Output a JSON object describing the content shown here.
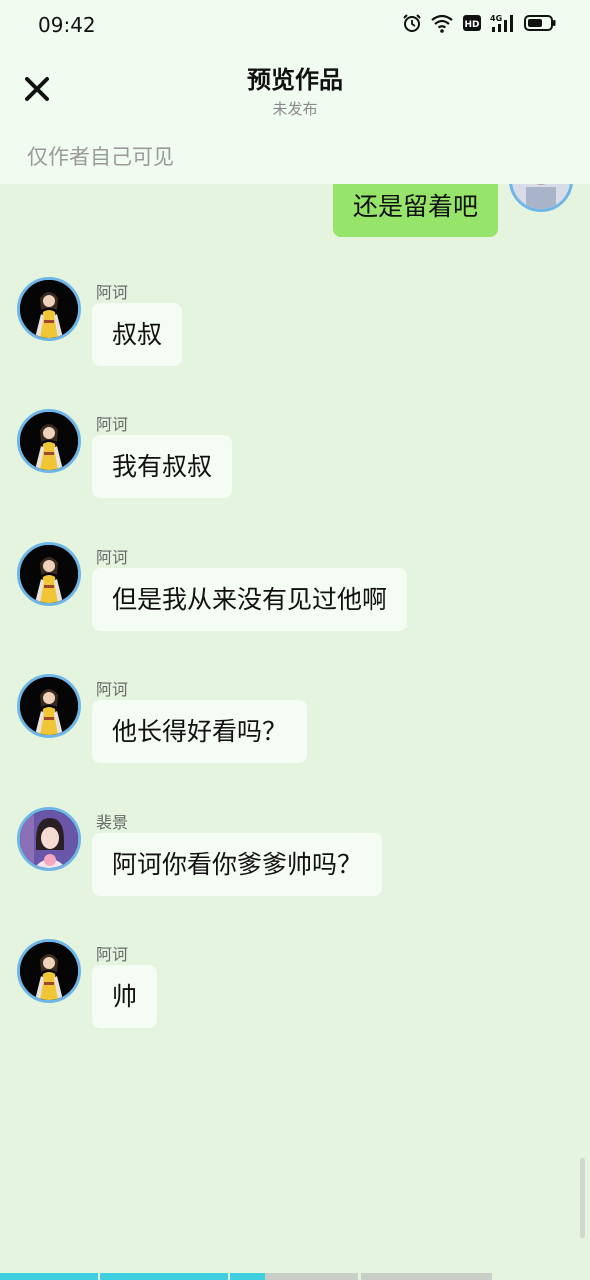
{
  "status_bar": {
    "time": "09:42",
    "icons": [
      "alarm-icon",
      "wifi-icon",
      "hd-icon",
      "signal-4g-icon",
      "battery-icon"
    ]
  },
  "header": {
    "title": "预览作品",
    "subtitle": "未发布",
    "visibility_note": "仅作者自己可见"
  },
  "self_message": {
    "text": "还是留着吧"
  },
  "messages": [
    {
      "sender": "阿诃",
      "text": "叔叔"
    },
    {
      "sender": "阿诃",
      "text": "我有叔叔"
    },
    {
      "sender": "阿诃",
      "text": "但是我从来没有见过他啊"
    },
    {
      "sender": "阿诃",
      "text": "他长得好看吗？"
    },
    {
      "sender": "裴景",
      "text": "阿诃你看你爹爹帅吗？"
    },
    {
      "sender": "阿诃",
      "text": "帅"
    }
  ],
  "colors": {
    "background": "#e4f4de",
    "header": "#f1fcf0",
    "self_bubble": "#96e56a",
    "other_bubble": "#f5fcf3",
    "avatar_ring": "#6fb6e8",
    "progress": "#3fcde0"
  },
  "progress_segments": 5
}
